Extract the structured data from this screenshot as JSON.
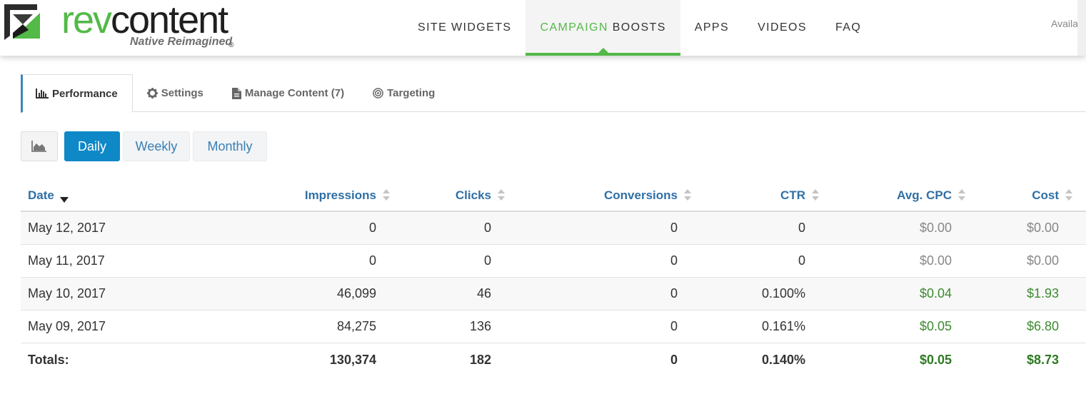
{
  "brand": {
    "rev": "rev",
    "content": "content",
    "tm": "®",
    "tagline": "Native Reimagined",
    "color_green": "#53b947"
  },
  "nav": {
    "items": [
      {
        "label": "SITE WIDGETS"
      },
      {
        "label_green": "CAMPAIGN",
        "label_rest": " BOOSTS",
        "active": true
      },
      {
        "label": "APPS"
      },
      {
        "label": "VIDEOS"
      },
      {
        "label": "FAQ"
      }
    ],
    "right_text": "Availab"
  },
  "tabs": [
    {
      "label": "Performance",
      "icon": "bar-chart-icon",
      "active": true
    },
    {
      "label": "Settings",
      "icon": "gear-icon"
    },
    {
      "label": "Manage Content (7)",
      "icon": "document-icon"
    },
    {
      "label": "Targeting",
      "icon": "target-icon"
    }
  ],
  "periods": {
    "chart_icon": "area-chart-icon",
    "daily": "Daily",
    "weekly": "Weekly",
    "monthly": "Monthly",
    "selected": "Daily"
  },
  "table": {
    "columns": [
      "Date",
      "Impressions",
      "Clicks",
      "Conversions",
      "CTR",
      "Avg. CPC",
      "Cost"
    ],
    "rows": [
      {
        "date": "May 12, 2017",
        "impressions": "0",
        "clicks": "0",
        "conversions": "0",
        "ctr": "0",
        "cpc": "$0.00",
        "cost": "$0.00"
      },
      {
        "date": "May 11, 2017",
        "impressions": "0",
        "clicks": "0",
        "conversions": "0",
        "ctr": "0",
        "cpc": "$0.00",
        "cost": "$0.00"
      },
      {
        "date": "May 10, 2017",
        "impressions": "46,099",
        "clicks": "46",
        "conversions": "0",
        "ctr": "0.100%",
        "cpc": "$0.04",
        "cost": "$1.93"
      },
      {
        "date": "May 09, 2017",
        "impressions": "84,275",
        "clicks": "136",
        "conversions": "0",
        "ctr": "0.161%",
        "cpc": "$0.05",
        "cost": "$6.80"
      }
    ],
    "totals": {
      "label": "Totals:",
      "impressions": "130,374",
      "clicks": "182",
      "conversions": "0",
      "ctr": "0.140%",
      "cpc": "$0.05",
      "cost": "$8.73"
    }
  }
}
